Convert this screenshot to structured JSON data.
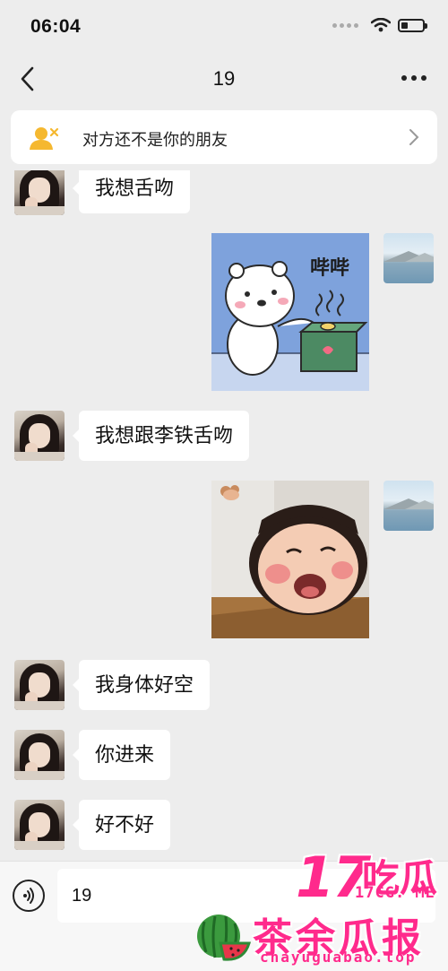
{
  "status_bar": {
    "time": "06:04",
    "battery_level": 0.3
  },
  "nav": {
    "title": "19",
    "back_icon": "chevron-left-icon",
    "more_icon": "more-dots-icon"
  },
  "friend_banner": {
    "text": "对方还不是你的朋友",
    "icon": "add-friend-icon"
  },
  "messages": [
    {
      "side": "left",
      "type": "text",
      "text": "我想舌吻"
    },
    {
      "side": "right",
      "type": "sticker",
      "sticker": "bear-pressing-button",
      "caption": "哔哔"
    },
    {
      "side": "left",
      "type": "text",
      "text": "我想跟李铁舌吻"
    },
    {
      "side": "right",
      "type": "sticker",
      "sticker": "laughing-baby"
    },
    {
      "side": "left",
      "type": "text",
      "text": "我身体好空"
    },
    {
      "side": "left",
      "type": "text",
      "text": "你进来"
    },
    {
      "side": "left",
      "type": "text",
      "text": "好不好"
    }
  ],
  "input": {
    "value": "19",
    "voice_icon": "voice-icon"
  },
  "watermark": {
    "num": "17",
    "cn1": "吃瓜",
    "domain1": "17CG. ME",
    "cn2": "茶余瓜报",
    "domain2": "chayuguabao.top"
  },
  "colors": {
    "background": "#ededed",
    "bubble": "#ffffff",
    "watermark": "#ff2a8c"
  }
}
